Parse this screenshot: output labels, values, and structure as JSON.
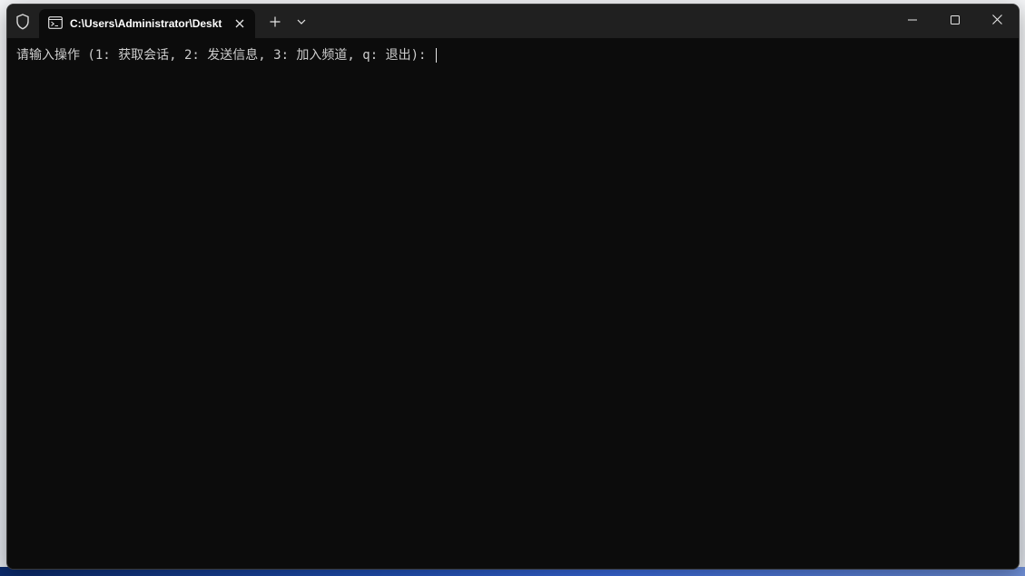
{
  "window": {
    "tab_title": "C:\\Users\\Administrator\\Deskt",
    "icons": {
      "shield": "shield-icon",
      "terminal": "terminal-icon",
      "tab_close": "close-icon",
      "new_tab": "plus-icon",
      "dropdown": "chevron-down-icon",
      "minimize": "minimize-icon",
      "maximize": "maximize-icon",
      "close": "close-icon"
    }
  },
  "terminal": {
    "prompt": "请输入操作 (1: 获取会话, 2: 发送信息, 3: 加入频道, q: 退出): "
  },
  "colors": {
    "titlebar": "#202020",
    "terminal_bg": "#0c0c0c",
    "text": "#cccccc"
  }
}
